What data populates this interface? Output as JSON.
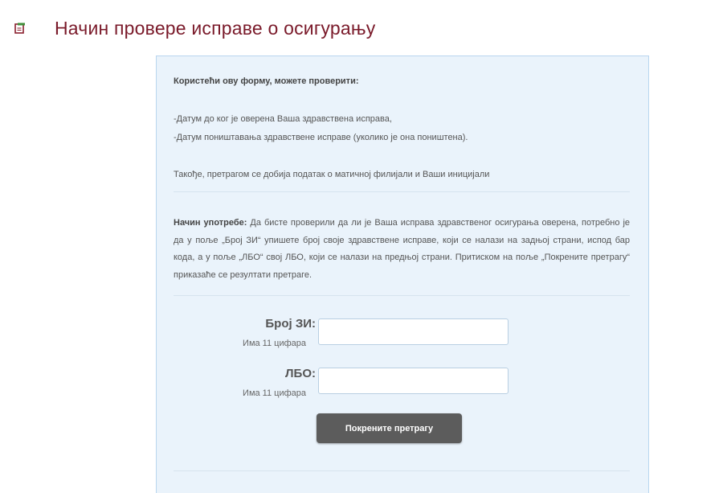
{
  "page": {
    "title": "Начин провере исправе о осигурању",
    "icon": "form-check-icon"
  },
  "info": {
    "heading": "Користећи ову форму, можете проверити:",
    "items": [
      "-Датум до ког је оверена Ваша здравствена исправа,",
      "-Датум поништавања здравствене исправе (уколико је она поништена)."
    ],
    "also": "Такође, претрагом се добија податак о матичној филијали и Ваши иницијали"
  },
  "usage": {
    "label": "Начин употребе:",
    "text": " Да бисте проверили да ли је Ваша исправа здравственог осигурања оверена, потребно је да у поље „Број ЗИ“ упишете број своје здравствене исправе, који се налази на задњој страни, испод бар кода,  а у поље „ЛБО“ свој ЛБО, који се налази на предњој страни. Притиском на поље „Покрените претрагу“ приказаће се резултати претраге."
  },
  "form": {
    "zi_label": "Број ЗИ:",
    "zi_hint": "Има 11 цифара",
    "zi_value": "",
    "lbo_label": "ЛБО:",
    "lbo_hint": "Има 11 цифара",
    "lbo_value": "",
    "submit_label": "Покрените претрагу"
  },
  "colors": {
    "title": "#7a1a2a",
    "panel_bg": "#eaf3fb",
    "panel_border": "#b9d6ef",
    "button_bg": "#5c5c5c"
  }
}
